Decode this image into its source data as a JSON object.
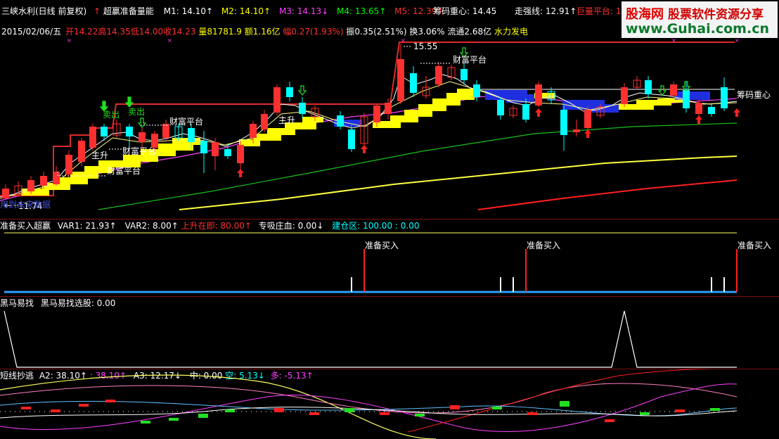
{
  "colors": {
    "up": "#ff3030",
    "down": "#00ffff",
    "m1": "#ffffff",
    "m2": "#ffff00",
    "m3": "#ff00ff",
    "m4": "#00ff00",
    "m5": "#ff3030",
    "platform": "#ffff00",
    "resistance": "#e03030",
    "sep": "#7a1010"
  },
  "header": {
    "row1": [
      {
        "text": "三峡水利(日线 前复权)",
        "color": "#ffffff"
      },
      {
        "text": "↑",
        "color": "#ff3030"
      },
      {
        "text": "超赢准备量能",
        "color": "#ffffff"
      },
      {
        "text": "M1: 14.10↑",
        "color": "#ffffff"
      },
      {
        "text": "M2: 14.10↑",
        "color": "#ffff00"
      },
      {
        "text": "M3: 14.13↓",
        "color": "#ff40ff"
      },
      {
        "text": "M4: 13.65↑",
        "color": "#00ff00"
      },
      {
        "text": "M5: 12.39↑",
        "color": "#ff3030"
      },
      {
        "text": "筹码重心: 14.45",
        "color": "#ffffff"
      },
      {
        "text": "走强线: 12.91↑",
        "color": "#ffffff"
      },
      {
        "text": "巨量平台: 1",
        "color": "#ff3030"
      }
    ],
    "row2": [
      {
        "text": "2015/02/06/五",
        "color": "#ffffff"
      },
      {
        "text": "开14.22",
        "color": "#ff3030"
      },
      {
        "text": "高14.35",
        "color": "#ff3030"
      },
      {
        "text": "低14.00",
        "color": "#ff3030"
      },
      {
        "text": "收14.23",
        "color": "#ff3030"
      },
      {
        "text": "量81781.9",
        "color": "#ffff00"
      },
      {
        "text": "额1.16亿",
        "color": "#ffff00"
      },
      {
        "text": "幅0.27(1.93%)",
        "color": "#ff3030"
      },
      {
        "text": "振0.35(2.51%)",
        "color": "#ffffff"
      },
      {
        "text": "换3.06%",
        "color": "#ffffff"
      },
      {
        "text": "流通2.68亿",
        "color": "#ffffff"
      },
      {
        "text": "水力发电",
        "color": "#ffff00"
      }
    ]
  },
  "watermark": {
    "brand": "股海网",
    "slogan": "股票软件资源分享",
    "url": "www.Guhai.com.cn"
  },
  "main_labels": {
    "high": "15.55",
    "low": "11.74",
    "chip_center": "筹码重心",
    "wealth1": "财富平台",
    "wealth2": "财富平台",
    "wealth3": "财富平台",
    "wealth4": "财富平台",
    "main1": "主升",
    "main2": "主升",
    "sell1": "卖出",
    "sell2": "卖出",
    "overlay": "用到未来数据"
  },
  "panel2": {
    "items": [
      {
        "text": "准备买入超赢",
        "color": "#ffffff"
      },
      {
        "text": "VAR1: 21.93↑",
        "color": "#ffffff"
      },
      {
        "text": "VAR2: 8.00↑",
        "color": "#ffffff"
      },
      {
        "text": "上升在即: 80.00↑",
        "color": "#ff3030"
      },
      {
        "text": "专吸庄血: 0.00↓",
        "color": "#ffffff"
      },
      {
        "text": "建仓区: 100.00 : 0.00",
        "color": "#00ffff"
      }
    ],
    "signal": "准备买入"
  },
  "panel3": {
    "items": [
      {
        "text": "黑马易找",
        "color": "#ffffff"
      },
      {
        "text": "黑马易找选股: 0.00",
        "color": "#ffffff"
      }
    ]
  },
  "panel4": {
    "items": [
      {
        "text": "短线抄逃",
        "color": "#ffffff"
      },
      {
        "text": "A2: 38.10↑",
        "color": "#ffffff"
      },
      {
        "text": ": 38.10↑",
        "color": "#ff40ff"
      },
      {
        "text": "A3: 12.17↓",
        "color": "#ffffff"
      },
      {
        "text": "中: 0.00",
        "color": "#ffffff"
      },
      {
        "text": "空: 5.13↓",
        "color": "#00ffff"
      },
      {
        "text": "多: -5.13↑",
        "color": "#ff40ff"
      }
    ]
  }
}
